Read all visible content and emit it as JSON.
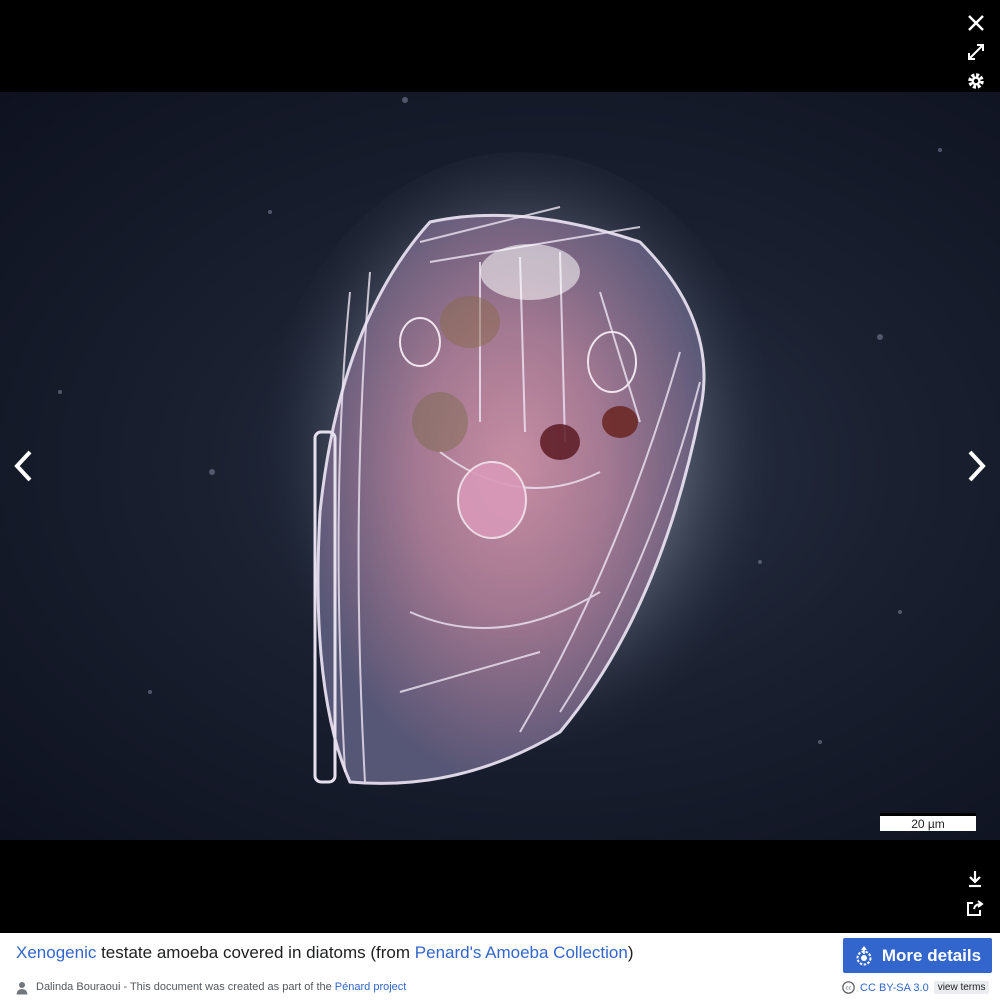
{
  "viewer": {
    "icons": {
      "close": "close-icon",
      "fullscreen": "fullscreen-icon",
      "settings": "gear-icon",
      "prev": "chevron-left-icon",
      "next": "chevron-right-icon",
      "download": "download-icon",
      "share": "share-icon"
    },
    "scalebar_label": "20 µm"
  },
  "caption": {
    "link1": "Xenogenic",
    "text1": " testate amoeba covered in diatoms (from ",
    "link2": "Penard's Amoeba Collection",
    "text2": ")"
  },
  "more_details": {
    "label": "More details",
    "icon": "commons-logo-icon"
  },
  "credit": {
    "author": "Dalinda Bouraoui",
    "text": " - This document was created as part of the ",
    "project_link": "Pénard project"
  },
  "license": {
    "label": "CC BY-SA 3.0",
    "terms_label": "view terms",
    "icon": "cc-icon"
  },
  "colors": {
    "accent": "#3366cc",
    "background": "#000000"
  }
}
